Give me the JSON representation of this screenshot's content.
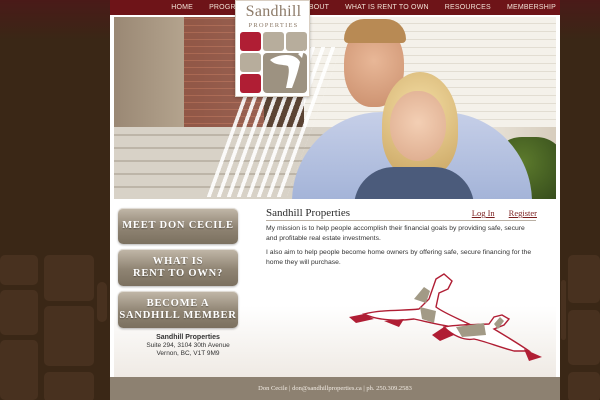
{
  "nav": {
    "items": [
      "HOME",
      "PROGRAM OVERVIEW",
      "ABOUT",
      "WHAT IS RENT TO OWN",
      "RESOURCES",
      "MEMBERSHIP"
    ]
  },
  "logo": {
    "wordmark": "Sandhill",
    "subtitle": "PROPERTIES"
  },
  "sidebar": {
    "buttons": [
      {
        "line1": "MEET DON CECILE",
        "line2": ""
      },
      {
        "line1": "WHAT IS",
        "line2": "RENT TO OWN?"
      },
      {
        "line1": "BECOME A",
        "line2": "SANDHILL MEMBER"
      }
    ],
    "address": {
      "name": "Sandhill Properties",
      "line1": "Suite 294, 3104 30th Avenue",
      "line2": "Vernon, BC, V1T 9M9"
    }
  },
  "main": {
    "title": "Sandhill Properties",
    "login": "Log In",
    "register": "Register",
    "paragraph1": "My mission is to help people accomplish their financial goals by providing safe, secure and profitable real estate investments.",
    "paragraph2": "I also aim to help people become home owners by offering safe, secure financing for the home they will purchase."
  },
  "footer": {
    "text": "Don Cecile | don@sandhillproperties.ca | ph. 250.309.2583"
  },
  "colors": {
    "nav_bg": "#6e1418",
    "brand_red": "#b01e34",
    "button_taupe": "#8f8473",
    "page_bg": "#3a2716"
  }
}
